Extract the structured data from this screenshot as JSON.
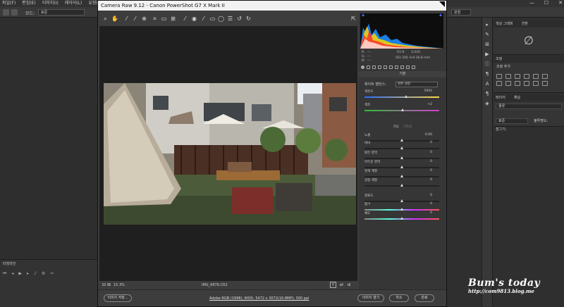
{
  "photoshop": {
    "menu": [
      "파일(F)",
      "편집(E)",
      "이미지(I)",
      "레이어(L)",
      "유형(Y)",
      "선"
    ],
    "options": {
      "mode_label": "모드:",
      "mode_value": "표준",
      "right_select": "원형"
    },
    "window_controls": [
      "—",
      "☐",
      "✕"
    ],
    "timeline": {
      "title": "타임라인"
    },
    "panels": {
      "properties": {
        "tabs": [
          "색상 그래퍼",
          "견본"
        ]
      },
      "adjustments": {
        "tabs": [
          "조정"
        ],
        "subtitle": "조정 추가"
      },
      "layers": {
        "tabs": [
          "레이어",
          "채널"
        ],
        "kind": "종류",
        "blend_mode": "표준",
        "opacity": "불투명도:",
        "lock": "잠그기:"
      }
    }
  },
  "camera_raw": {
    "title": "Camera Raw 9.12  -  Canon PowerShot G7 X Mark II",
    "zoom": "15.3%",
    "filename": "IMG_6876.CR2",
    "workflow_link": "Adobe RGB (1998); 8비트; 5472 x 3072(16.8MP); 300 ppi",
    "buttons": {
      "save": "이미지 저장...",
      "open": "이미지 열기",
      "cancel": "취소",
      "done": "완료"
    },
    "meta": {
      "r": "R:",
      "g": "G:",
      "b": "B:",
      "dash": "---",
      "aperture": "f/2.8",
      "shutter": "1/320",
      "iso": "ISO 200",
      "lens": "8.8-36.8 mm"
    },
    "basic_header": "기본",
    "wb": {
      "label": "화이트 밸런스:",
      "value": "원본 설정"
    },
    "auto": {
      "auto": "자동",
      "default": "기본값"
    },
    "sliders": [
      {
        "label": "색온도",
        "value": "5950",
        "pos": 0.56
      },
      {
        "label": "색조",
        "value": "+2",
        "pos": 0.51
      },
      {
        "label": "노출",
        "value": "0.00",
        "pos": 0.5
      },
      {
        "label": "대비",
        "value": "0",
        "pos": 0.5
      },
      {
        "label": "밝은 영역",
        "value": "0",
        "pos": 0.5
      },
      {
        "label": "어두운 영역",
        "value": "0",
        "pos": 0.5
      },
      {
        "label": "흰색 계열",
        "value": "0",
        "pos": 0.5
      },
      {
        "label": "검정 계열",
        "value": "0",
        "pos": 0.5
      },
      {
        "label": "명료도",
        "value": "0",
        "pos": 0.5
      },
      {
        "label": "활기",
        "value": "0",
        "pos": 0.5
      },
      {
        "label": "채도",
        "value": "0",
        "pos": 0.5
      }
    ]
  },
  "watermark": {
    "title": "Bum's today",
    "url": "http://com9813.blog.me"
  }
}
